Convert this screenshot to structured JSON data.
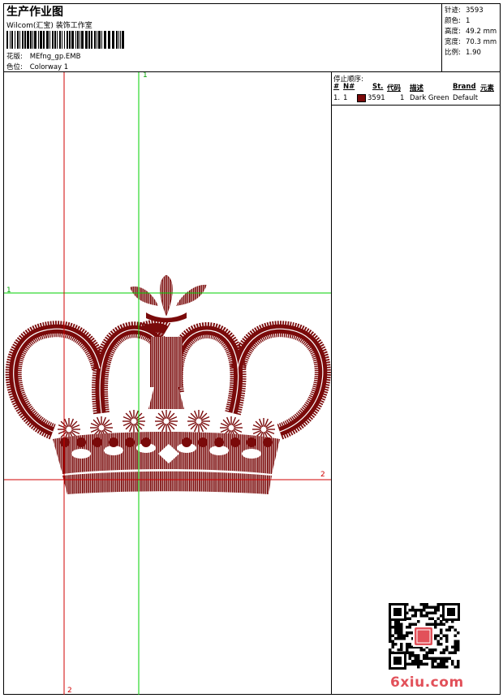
{
  "header": {
    "title": "生产作业图",
    "studio": "Wilcom(汇宝) 装饰工作室",
    "design_label": "花版:",
    "design_value": "MEfng_gp.EMB",
    "colorway_label": "色位:",
    "colorway_value": "Colorway 1"
  },
  "stats": {
    "stitches_label": "针迹:",
    "stitches_value": "3593",
    "colors_label": "颜色:",
    "colors_value": "1",
    "height_label": "高度:",
    "height_value": "49.2 mm",
    "width_label": "宽度:",
    "width_value": "70.3 mm",
    "scale_label": "比例:",
    "scale_value": "1.90"
  },
  "stop_sequence": {
    "title": "停止顺序:",
    "headers": {
      "stop": "#",
      "needle": "N#",
      "stitches": "St.",
      "code": "代码",
      "description": "描述",
      "brand": "Brand",
      "element": "元素"
    },
    "rows": [
      {
        "stop": "1.",
        "needle": "1",
        "stitches": "3591",
        "code": "1",
        "description": "Dark Green",
        "brand": "Default",
        "color": "#7a0a0a"
      }
    ]
  },
  "guides": {
    "green_top": "1",
    "green_left": "1",
    "red_right": "2",
    "red_bottom": "2"
  },
  "design": {
    "thread_color": "#7a0a0a",
    "guide_green": "#00d000",
    "guide_red": "#d00000"
  },
  "watermark": {
    "site": "6xiu.com",
    "qr_icon": "qr-code-icon"
  }
}
